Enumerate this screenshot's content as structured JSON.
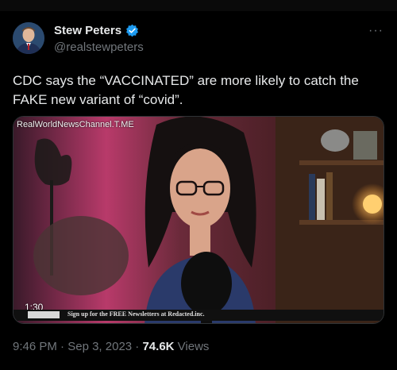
{
  "author": {
    "name": "Stew Peters",
    "handle": "@realstewpeters",
    "verified": true,
    "verified_color": "#1d9bf0"
  },
  "menu": {
    "icon": "more-dots-icon",
    "glyph": "···"
  },
  "tweet": {
    "text": "CDC says the “VACCINATED” are more likely to catch the FAKE new variant of “covid”."
  },
  "video": {
    "watermark": "RealWorldNewsChannel.T.ME",
    "duration": "1:30",
    "ticker_text": "Sign up for the FREE Newsletters at Redacted.inc."
  },
  "meta": {
    "time": "9:46 PM",
    "separator": "·",
    "date": "Sep 3, 2023",
    "views_count": "74.6K",
    "views_label": "Views"
  }
}
